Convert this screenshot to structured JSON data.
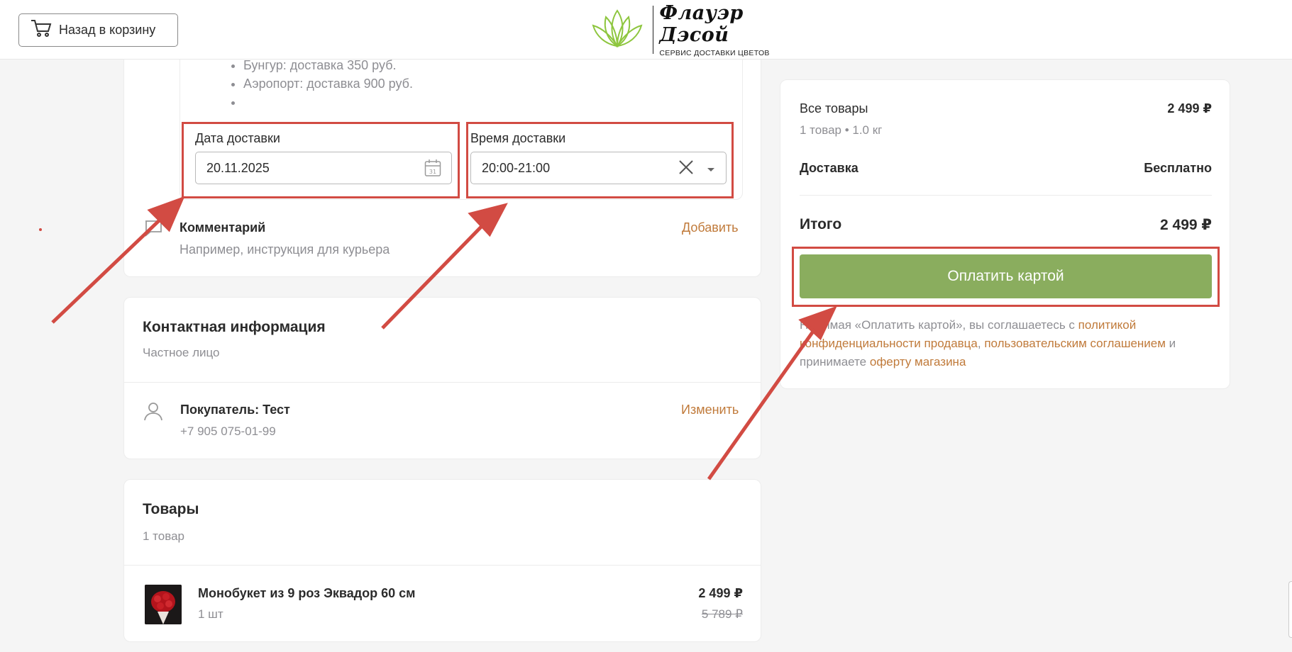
{
  "header": {
    "back_label": "Назад в корзину",
    "brand_name": "Флауэр Дэсой",
    "brand_tagline": "СЕРВИС ДОСТАВКИ ЦВЕТОВ"
  },
  "delivery": {
    "zones": [
      "Бунгур: доставка 350 руб.",
      "Аэропорт: доставка 900 руб.",
      ""
    ],
    "date_label": "Дата доставки",
    "date_value": "20.11.2025",
    "time_label": "Время доставки",
    "time_value": "20:00-21:00",
    "calendar_day": "31"
  },
  "comment": {
    "title": "Комментарий",
    "placeholder": "Например, инструкция для курьера",
    "add_label": "Добавить"
  },
  "contact": {
    "title": "Контактная информация",
    "subtitle": "Частное лицо",
    "buyer": "Покупатель: Тест",
    "phone": "+7 905 075-01-99",
    "change_label": "Изменить"
  },
  "goods": {
    "title": "Товары",
    "count": "1 товар",
    "items": [
      {
        "name": "Монобукет из 9 роз Эквадор 60 см",
        "qty": "1 шт",
        "price": "2 499 ₽",
        "old_price": "5 789 ₽"
      }
    ]
  },
  "summary": {
    "all_goods_label": "Все товары",
    "all_goods_value": "2 499 ₽",
    "goods_meta": "1 товар • 1.0 кг",
    "delivery_label": "Доставка",
    "delivery_value": "Бесплатно",
    "total_label": "Итого",
    "total_value": "2 499 ₽",
    "pay_label": "Оплатить картой",
    "legal_prefix": "Нажимая «Оплатить картой», вы соглашаетесь с ",
    "legal_link1": "политикой конфиденциальности продавца",
    "legal_sep": ", ",
    "legal_link2": "пользовательским соглашением",
    "legal_mid": " и принимаете ",
    "legal_link3": "оферту магазина"
  },
  "colors": {
    "accent_green": "#8aad5e",
    "link_orange": "#c07a3a",
    "annotation_red": "#d24b43"
  }
}
